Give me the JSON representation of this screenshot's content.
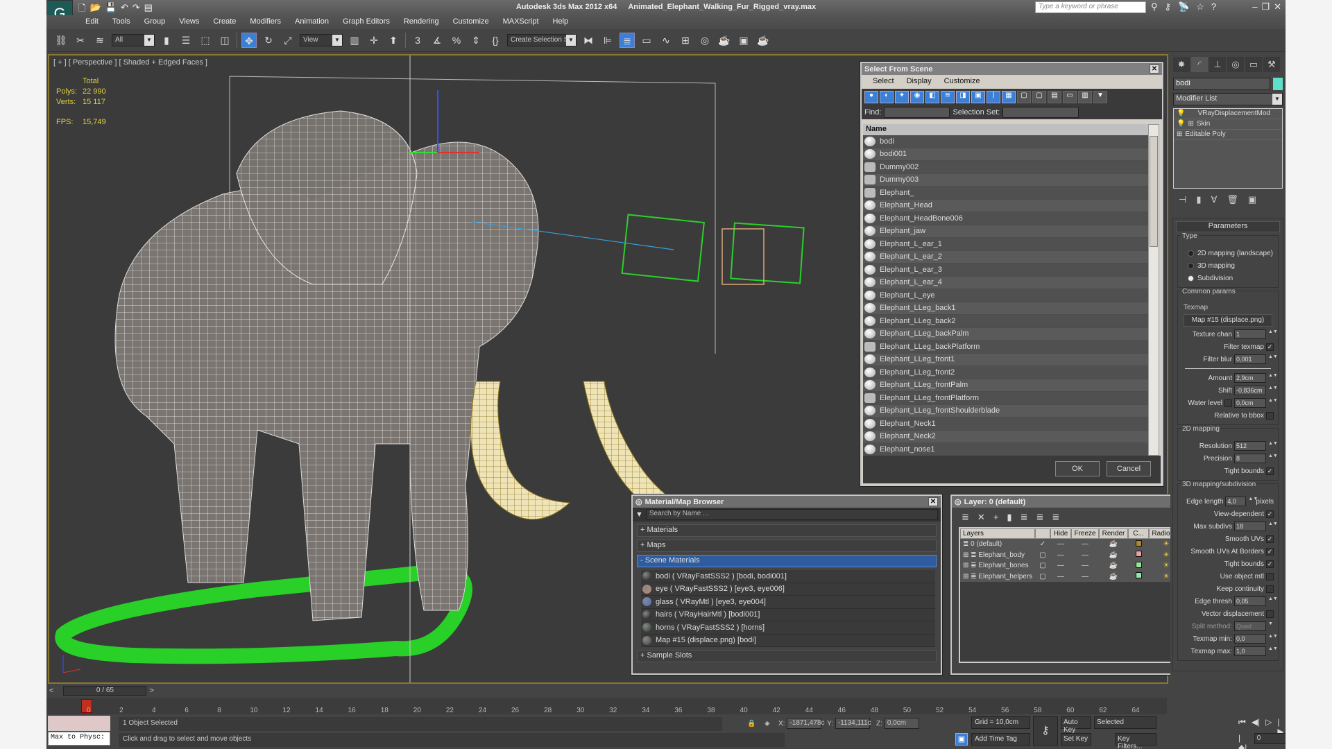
{
  "window": {
    "app_title": "Autodesk 3ds Max  2012 x64",
    "file_name": "Animated_Elephant_Walking_Fur_Rigged_vray.max",
    "search_placeholder": "Type a keyword or phrase"
  },
  "menu": [
    "Edit",
    "Tools",
    "Group",
    "Views",
    "Create",
    "Modifiers",
    "Animation",
    "Graph Editors",
    "Rendering",
    "Customize",
    "MAXScript",
    "Help"
  ],
  "toolbar": {
    "selection_filter": "All",
    "ref_coord": "View",
    "named_selection": "Create Selection Se"
  },
  "viewport": {
    "label": "[ + ] [ Perspective ] [ Shaded + Edged Faces ]",
    "stats_header": "Total",
    "polys_label": "Polys:",
    "polys": "22 990",
    "verts_label": "Verts:",
    "verts": "15 117",
    "fps_label": "FPS:",
    "fps": "15,749"
  },
  "select_from_scene": {
    "title": "Select From Scene",
    "menu": [
      "Select",
      "Display",
      "Customize"
    ],
    "find_label": "Find:",
    "selection_set_label": "Selection Set:",
    "column": "Name",
    "items": [
      {
        "name": "bodi",
        "type": "geometry"
      },
      {
        "name": "bodi001",
        "type": "geometry"
      },
      {
        "name": "Dummy002",
        "type": "helper"
      },
      {
        "name": "Dummy003",
        "type": "helper"
      },
      {
        "name": "Elephant_",
        "type": "helper"
      },
      {
        "name": "Elephant_Head",
        "type": "geometry"
      },
      {
        "name": "Elephant_HeadBone006",
        "type": "geometry"
      },
      {
        "name": "Elephant_jaw",
        "type": "geometry"
      },
      {
        "name": "Elephant_L_ear_1",
        "type": "geometry"
      },
      {
        "name": "Elephant_L_ear_2",
        "type": "geometry"
      },
      {
        "name": "Elephant_L_ear_3",
        "type": "geometry"
      },
      {
        "name": "Elephant_L_ear_4",
        "type": "geometry"
      },
      {
        "name": "Elephant_L_eye",
        "type": "geometry"
      },
      {
        "name": "Elephant_LLeg_back1",
        "type": "geometry"
      },
      {
        "name": "Elephant_LLeg_back2",
        "type": "geometry"
      },
      {
        "name": "Elephant_LLeg_backPalm",
        "type": "geometry"
      },
      {
        "name": "Elephant_LLeg_backPlatform",
        "type": "helper"
      },
      {
        "name": "Elephant_LLeg_front1",
        "type": "geometry"
      },
      {
        "name": "Elephant_LLeg_front2",
        "type": "geometry"
      },
      {
        "name": "Elephant_LLeg_frontPalm",
        "type": "geometry"
      },
      {
        "name": "Elephant_LLeg_frontPlatform",
        "type": "helper"
      },
      {
        "name": "Elephant_LLeg_frontShoulderblade",
        "type": "geometry"
      },
      {
        "name": "Elephant_Neck1",
        "type": "geometry"
      },
      {
        "name": "Elephant_Neck2",
        "type": "geometry"
      },
      {
        "name": "Elephant_nose1",
        "type": "geometry"
      }
    ],
    "ok": "OK",
    "cancel": "Cancel"
  },
  "material_browser": {
    "title": "Material/Map Browser",
    "search_placeholder": "Search by Name ...",
    "sections": {
      "materials": "+ Materials",
      "maps": "+ Maps",
      "scene": "- Scene Materials",
      "sample": "+ Sample Slots"
    },
    "scene_materials": [
      {
        "label": "bodi  ( VRayFastSSS2 ) [bodi, bodi001]",
        "swatch": "#1a1a1a"
      },
      {
        "label": "eye  ( VRayFastSSS2 ) [eye3, eye006]",
        "swatch": "#c08870"
      },
      {
        "label": "glass  ( VRayMtl ) [eye3, eye004]",
        "swatch": "#4a6ad0"
      },
      {
        "label": "hairs  ( VRayHairMtl ) [bodi001]",
        "swatch": "#0d0d0d"
      },
      {
        "label": "horns  ( VRayFastSSS2 ) [horns]",
        "swatch": "#2a3a2a"
      },
      {
        "label": "Map #15 (displace.png) [bodi]",
        "swatch": "#444444"
      }
    ]
  },
  "layer_manager": {
    "title": "Layer: 0 (default)",
    "columns": [
      "Layers",
      "",
      "Hide",
      "Freeze",
      "Render",
      "C...",
      "Radiosity"
    ],
    "layers": [
      {
        "name": "0 (default)",
        "current": true,
        "color": "#b08a20"
      },
      {
        "name": "Elephant_body",
        "current": false,
        "color": "#e8a0a0"
      },
      {
        "name": "Elephant_bones",
        "current": false,
        "color": "#90e890"
      },
      {
        "name": "Elephant_helpers",
        "current": false,
        "color": "#90e8b0"
      }
    ]
  },
  "command_panel": {
    "object_name": "bodi",
    "object_color": "#5ee0c8",
    "modifier_list": "Modifier List",
    "stack": [
      "VRayDisplacementMod",
      "Skin",
      "Editable Poly"
    ],
    "rollout": "Parameters",
    "type_group": "Type",
    "type_options": [
      "2D mapping (landscape)",
      "3D mapping",
      "Subdivision"
    ],
    "type_selected": "Subdivision",
    "common_group": "Common params",
    "texmap_label": "Texmap",
    "texmap": "Map #15 (displace.png)",
    "texture_chan": {
      "label": "Texture chan",
      "value": "1"
    },
    "filter_texmap": {
      "label": "Filter texmap",
      "checked": true
    },
    "filter_blur": {
      "label": "Filter blur",
      "value": "0,001"
    },
    "amount": {
      "label": "Amount",
      "value": "2,9cm"
    },
    "shift": {
      "label": "Shift",
      "value": "-0,836cm"
    },
    "water_level": {
      "label": "Water level",
      "checked": false,
      "value": "0,0cm"
    },
    "relative_bbox": {
      "label": "Relative to bbox",
      "checked": false
    },
    "map2d_group": "2D mapping",
    "resolution": {
      "label": "Resolution",
      "value": "512"
    },
    "precision": {
      "label": "Precision",
      "value": "8"
    },
    "tight_bounds_2d": {
      "label": "Tight bounds",
      "checked": true
    },
    "map3d_group": "3D mapping/subdivision",
    "edge_length": {
      "label": "Edge length",
      "value": "4,0",
      "unit": "pixels"
    },
    "view_dependent": {
      "label": "View-dependent",
      "checked": true
    },
    "max_subdivs": {
      "label": "Max subdivs",
      "value": "18"
    },
    "smooth_uvs": {
      "label": "Smooth UVs",
      "checked": true
    },
    "smooth_uvs_borders": {
      "label": "Smooth UVs At Borders",
      "checked": true
    },
    "tight_bounds_3d": {
      "label": "Tight bounds",
      "checked": true
    },
    "use_object_mtl": {
      "label": "Use object mtl",
      "checked": false
    },
    "keep_continuity": {
      "label": "Keep continuity",
      "checked": false
    },
    "edge_thresh": {
      "label": "Edge thresh",
      "value": "0,05"
    },
    "vector_disp": {
      "label": "Vector displacement",
      "checked": false
    },
    "split_method": {
      "label": "Split method:",
      "value": "Quad"
    },
    "texmap_min": {
      "label": "Texmap min:",
      "value": "0,0"
    },
    "texmap_max": {
      "label": "Texmap max:",
      "value": "1,0"
    }
  },
  "timeline": {
    "frame": "0 / 65",
    "current_frame": 0,
    "total_frames": 65,
    "ticks": [
      "0",
      "2",
      "4",
      "6",
      "8",
      "10",
      "12",
      "14",
      "16",
      "18",
      "20",
      "22",
      "24",
      "26",
      "28",
      "30",
      "32",
      "34",
      "36",
      "38",
      "40",
      "42",
      "44",
      "46",
      "48",
      "50",
      "52",
      "54",
      "56",
      "58",
      "60",
      "62",
      "64"
    ]
  },
  "status": {
    "maxscript_listener": "Max to Physc:",
    "selection": "1 Object Selected",
    "prompt": "Click and drag to select and move objects",
    "x_label": "X:",
    "x": "-1871,478c",
    "y_label": "Y:",
    "y": "-1134,111c",
    "z_label": "Z:",
    "z": "0,0cm",
    "grid": "Grid = 10,0cm",
    "add_time_tag": "Add Time Tag",
    "auto_key": "Auto Key",
    "set_key": "Set Key",
    "key_mode": "Selected",
    "key_filters": "Key Filters...",
    "current_frame_field": "0"
  }
}
